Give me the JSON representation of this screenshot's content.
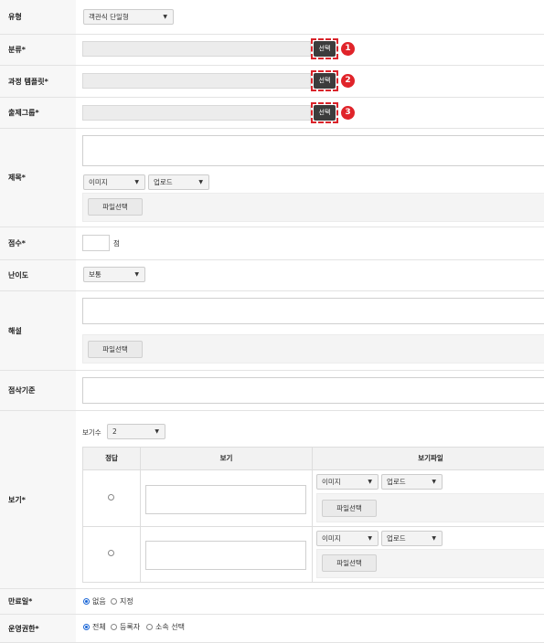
{
  "type_row": {
    "label": "유형",
    "select_value": "객관식 단일형"
  },
  "category_row": {
    "label": "분류*",
    "button": "선택",
    "badge": "1"
  },
  "template_row": {
    "label": "과정 템플릿*",
    "button": "선택",
    "badge": "2"
  },
  "group_row": {
    "label": "출제그룹*",
    "button": "선택",
    "badge": "3"
  },
  "title_row": {
    "label": "제목*",
    "media_select": "이미지",
    "upload_select": "업로드",
    "file_button": "파일선택"
  },
  "score_row": {
    "label": "점수*",
    "unit": "점"
  },
  "difficulty_row": {
    "label": "난이도",
    "select_value": "보통"
  },
  "explanation_row": {
    "label": "해설",
    "file_button": "파일선택"
  },
  "criteria_row": {
    "label": "점삭기준"
  },
  "options_row": {
    "label": "보기*",
    "count_label": "보기수",
    "count_value": "2",
    "headers": {
      "answer": "정답",
      "option": "보기",
      "file": "보기파일"
    },
    "rows": [
      {
        "media_select": "이미지",
        "upload_select": "업로드",
        "file_button": "파일선택"
      },
      {
        "media_select": "이미지",
        "upload_select": "업로드",
        "file_button": "파일선택"
      }
    ]
  },
  "expiry_row": {
    "label": "만료일*",
    "options": [
      "없음",
      "지정"
    ]
  },
  "permission_row": {
    "label": "운영권한*",
    "options": [
      "전체",
      "등록자",
      "소속 선택"
    ]
  },
  "colors": {
    "accent_red": "#e0242a",
    "dark_button": "#3c3c3c",
    "radio_blue": "#1a66d6"
  }
}
